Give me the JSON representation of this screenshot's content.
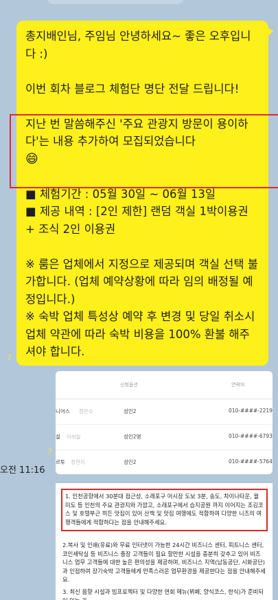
{
  "message": {
    "lines": [
      "총지배인님, 주임님 안녕하세요~ 좋은 오후입니다 :)",
      "",
      "이번 회차 블로그 체험단 명단 전달 드립니다!",
      "",
      "지난 번 말씀해주신 '주요 관광지 방문이 용이하다'는 내용 추가하여 모집되었습니다",
      "",
      "■ 체험기간 : 05월 30일 ~ 06월 13일",
      "■ 제공 내역 : [2인 제한] 랜덤 객실 1박이용권 + 조식 2인 이용권",
      "",
      "※ 룸은 업체에서 지정으로 제공되며 객실 선택 불가합니다. (업체 예약상황에 따라 임의 배정될 예정입니다.)",
      "※ 숙박 업체 특성상 예약 후 변경 및 당일 취소시 업체 약관에 따라 숙박 비용을 100% 환불 해주셔야 합니다."
    ],
    "smiley": "😄",
    "read_count": "7"
  },
  "image1": {
    "headers": [
      "신청옵션",
      "연락처"
    ],
    "rows": [
      {
        "name": "니어스",
        "person": "정은수",
        "option": "성인2",
        "phone": "010-####-2219"
      },
      {
        "name": "설",
        "person": "이하늘",
        "option": "성인2명",
        "phone": "010-####-6793"
      },
      {
        "name": "르투",
        "person": "정현지",
        "option": "성인2",
        "phone": "010-####-5764"
      }
    ],
    "read_count": "7"
  },
  "timestamp": "오전 11:16",
  "image2": {
    "paragraphs": [
      "1. 인천공항에서 30분대 접근성, 소래포구 어시장 도보 3분, 송도, 차이나타운, 월미도 등 인천의 주요 관광지와 가깝고, 소래포구에서 습지공원 까지 이어지는 조깅코스 및 호텔부근 히든 맛집이 있어 산책 및 맛집 여행에도 적합하여 다양한 니즈의 여행객들에게 적합하다는 점을 안내해주세요.",
      "2.복사 및 인쇄(유료)와 무료 인터넷이 가능한 24시간 비즈니스 센터, 피트니스 센터, 코인세탁실 등 비즈니스 출장 고객들이 필요 할만한 시설을 충분히 갖추고 있어 비즈니스 업무 고객들에 대한 높은 편의성을 제공하며, 비즈니스 지역(남동공단, 시화공단)과 인접하여 장기숙박 고객들에게 만족스러운 업무환경을 제공한다는 점을 안내해주세요.",
      "3. 최신 음향 시설과 빔프로젝터 및 다양한 연회 메뉴(뷔페, 양식코스, 한식)가 준비되어 있는 가"
    ]
  }
}
